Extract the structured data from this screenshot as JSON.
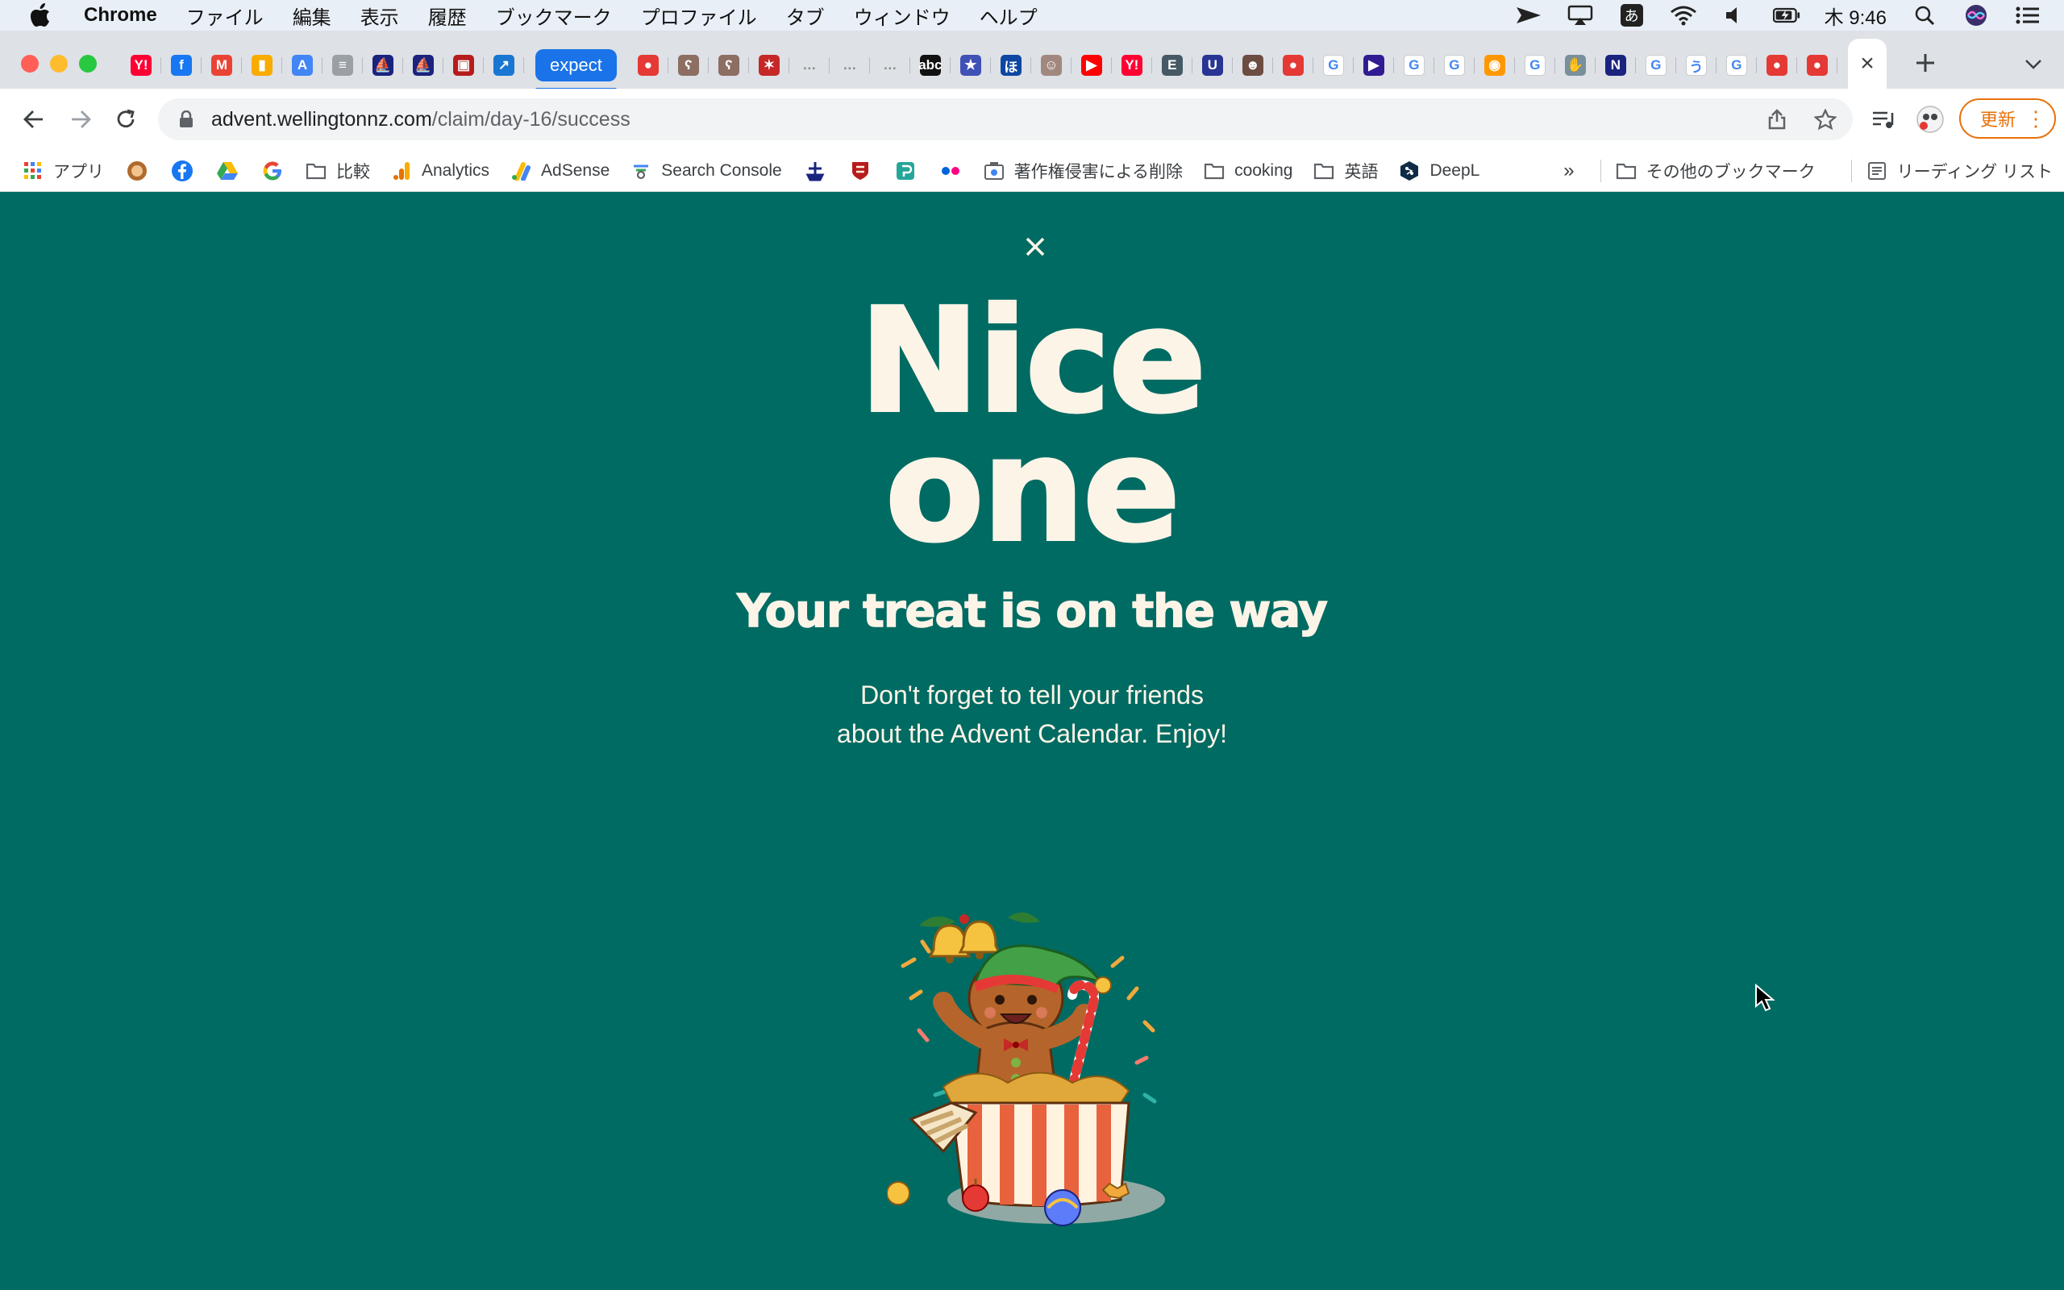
{
  "menubar": {
    "app_name": "Chrome",
    "items": [
      "ファイル",
      "編集",
      "表示",
      "履歴",
      "ブックマーク",
      "プロファイル",
      "タブ",
      "ウィンドウ",
      "ヘルプ"
    ],
    "input_method": "あ",
    "clock": "木 9:46"
  },
  "tabs": {
    "group_label": "expect",
    "favicons_before_group": [
      "yahoo",
      "facebook",
      "gmail",
      "analytics",
      "adsense",
      "search-console",
      "ship",
      "ship",
      "crest",
      "arrow"
    ],
    "favicons_after_group": [
      "red-circle",
      "bear",
      "bear",
      "figure",
      "dots",
      "dots",
      "dots",
      "abc",
      "star",
      "blue-square",
      "person",
      "youtube",
      "yahoo",
      "eigo",
      "u",
      "portrait",
      "red-circle",
      "google",
      "play",
      "google",
      "google",
      "color-wheel",
      "google",
      "hand",
      "n",
      "google",
      "hiragana",
      "google",
      "red-circle",
      "red-circle"
    ],
    "active_tab_close": "×"
  },
  "toolbar": {
    "url_host": "advent.wellingtonnz.com",
    "url_path": "/claim/day-16/success",
    "update_label": "更新"
  },
  "bookmarks": {
    "apps": "アプリ",
    "hikaku": "比較",
    "analytics": "Analytics",
    "adsense": "AdSense",
    "search_console": "Search Console",
    "copyright": "著作権侵害による削除",
    "cooking": "cooking",
    "eigo": "英語",
    "deepl": "DeepL",
    "more": "»",
    "other": "その他のブックマーク",
    "reading_list": "リーディング リスト"
  },
  "page": {
    "headline_line1": "Nice",
    "headline_line2": "one",
    "subheading": "Your treat is on the way",
    "body_line1": "Don't forget to tell your friends",
    "body_line2": "about the Advent Calendar. Enjoy!"
  },
  "colors": {
    "page_background": "#006b62",
    "text_cream": "#fdf4e8",
    "tab_group": "#1a73e8",
    "update_orange": "#e8710a"
  }
}
